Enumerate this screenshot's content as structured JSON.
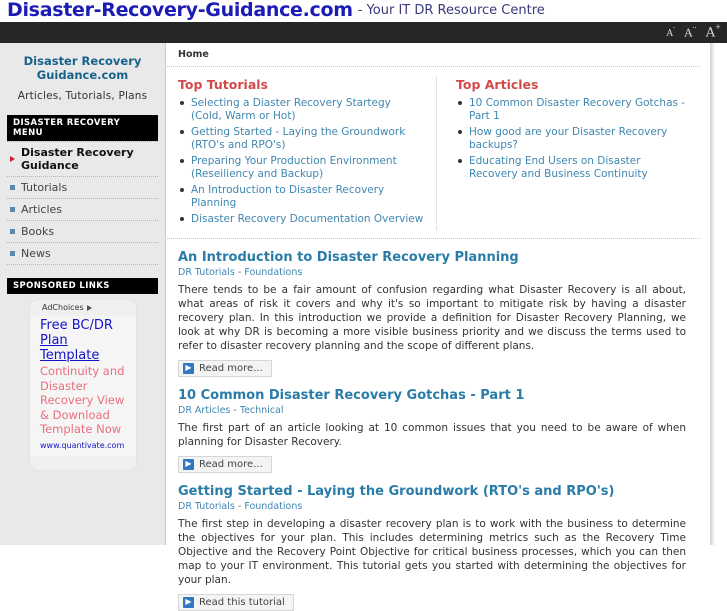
{
  "header": {
    "site_title": "Disaster-Recovery-Guidance.com",
    "tagline": "- Your IT DR Resource Centre",
    "text_size": {
      "decrease": "A",
      "decrease_sup": "-",
      "normal": "A",
      "normal_sup": "··",
      "increase": "A",
      "increase_sup": "+"
    }
  },
  "sidebar": {
    "logo_line1": "Disaster Recovery",
    "logo_line2": "Guidance.com",
    "logo_sub": "Articles, Tutorials, Plans",
    "menu_heading": "DISASTER RECOVERY MENU",
    "menu_items": [
      {
        "label": "Disaster Recovery Guidance",
        "active": true
      },
      {
        "label": "Tutorials",
        "active": false
      },
      {
        "label": "Articles",
        "active": false
      },
      {
        "label": "Books",
        "active": false
      },
      {
        "label": "News",
        "active": false
      }
    ],
    "sponsored_heading": "SPONSORED LINKS",
    "ad": {
      "adchoices_label": "AdChoices",
      "headline_plain": "Free BC/DR ",
      "headline_underlined": "Plan Template",
      "description": "Continuity and Disaster Recovery View & Download Template Now",
      "url": "www.quantivate.com"
    }
  },
  "main": {
    "breadcrumb": "Home",
    "top_tutorials": {
      "heading": "Top Tutorials",
      "items": [
        "Selecting a Diaster Recovery Startegy (Cold, Warm or Hot)",
        "Getting Started - Laying the Groundwork (RTO's and RPO's)",
        "Preparing Your Production Environment (Reseiliency and Backup)",
        "An Introduction to Disaster Recovery Planning",
        "Disaster Recovery Documentation Overview"
      ]
    },
    "top_articles": {
      "heading": "Top Articles",
      "items": [
        "10 Common Disaster Recovery Gotchas - Part 1",
        "How good are your Disaster Recovery backups?",
        "Educating End Users on Disaster Recovery and Business Continuity"
      ]
    },
    "articles": [
      {
        "title": "An Introduction to Disaster Recovery Planning",
        "category": "DR Tutorials",
        "separator": "-",
        "subcategory": "Foundations",
        "body": "There tends to be a fair amount of confusion regarding what Disaster Recovery is all about, what areas of risk it covers and why it's so important to mitigate risk by having a disaster recovery plan. In this introduction we provide a definition for Disaster Recovery Planning, we look at why DR is becoming a more visible business priority and we discuss the terms used to refer to disaster recovery planning and the scope of different plans.",
        "button": "Read more..."
      },
      {
        "title": "10 Common Disaster Recovery Gotchas - Part 1",
        "category": "DR Articles",
        "separator": "-",
        "subcategory": "Technical",
        "body": "The first part of an article looking at 10 common issues that you need to be aware of when planning for Disaster Recovery.",
        "button": "Read more..."
      },
      {
        "title": "Getting Started - Laying the Groundwork (RTO's and RPO's)",
        "category": "DR Tutorials",
        "separator": "-",
        "subcategory": "Foundations",
        "body": "The first step in developing a disaster recovery plan is to work with the business to determine the objectives for your plan. This includes determining metrics such as the Recovery Time Objective and the Recovery Point Objective for critical business processes, which you can then map to your IT environment. This tutorial gets you started with determining the objectives for your plan.",
        "button": "Read this tutorial"
      }
    ]
  },
  "colors": {
    "title_blue": "#1b1bb5",
    "heading_red": "#d24a4a",
    "link_blue": "#3f87b0",
    "article_title": "#2a7ca8",
    "sidebar_bg": "#e9e9e9",
    "utilbar_bg": "#262626",
    "ad_text_pink": "#e8707f"
  }
}
